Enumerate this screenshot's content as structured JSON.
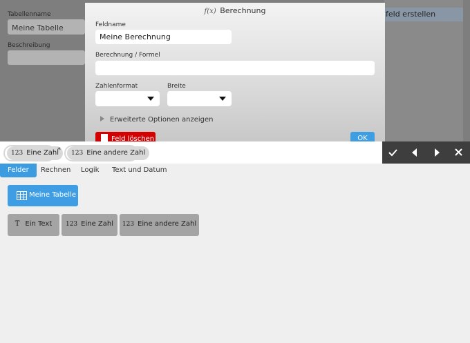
{
  "background": {
    "table_name_label": "Tabellenname",
    "table_name_value": "Meine Tabelle",
    "description_label": "Beschreibung",
    "description_value": "",
    "create_field_label": "feld erstellen"
  },
  "dialog": {
    "title_prefix": "f(x)",
    "title": "Berechnung",
    "field_name_label": "Feldname",
    "field_name_value": "Meine Berechnung",
    "formula_label": "Berechnung / Formel",
    "formula_value": "",
    "number_format_label": "Zahlenformat",
    "number_format_value": "",
    "width_label": "Breite",
    "width_value": "",
    "advanced_label": "Erweiterte Optionen anzeigen",
    "delete_label": "Feld löschen",
    "ok_label": "OK"
  },
  "formula": {
    "tokens": [
      {
        "type": "123",
        "label": "Eine Zahl"
      },
      {
        "type": "123",
        "label": "Eine andere Zahl"
      }
    ],
    "operator": "*"
  },
  "actions": {
    "confirm": "check-icon",
    "prev": "caret-left-icon",
    "next": "caret-right-icon",
    "close": "close-icon"
  },
  "tabs": [
    {
      "label": "Felder",
      "active": true
    },
    {
      "label": "Rechnen",
      "active": false
    },
    {
      "label": "Logik",
      "active": false
    },
    {
      "label": "Text und Datum",
      "active": false
    }
  ],
  "table_button": {
    "label": "Meine Tabelle"
  },
  "fields": [
    {
      "type": "T",
      "label": "Ein Text"
    },
    {
      "type": "123",
      "label": "Eine Zahl"
    },
    {
      "type": "123",
      "label": "Eine andere Zahl"
    }
  ],
  "colors": {
    "accent": "#3d9be0",
    "danger": "#d20000",
    "toolbar": "#3e3e3e",
    "field_button": "#a4a4a4"
  }
}
